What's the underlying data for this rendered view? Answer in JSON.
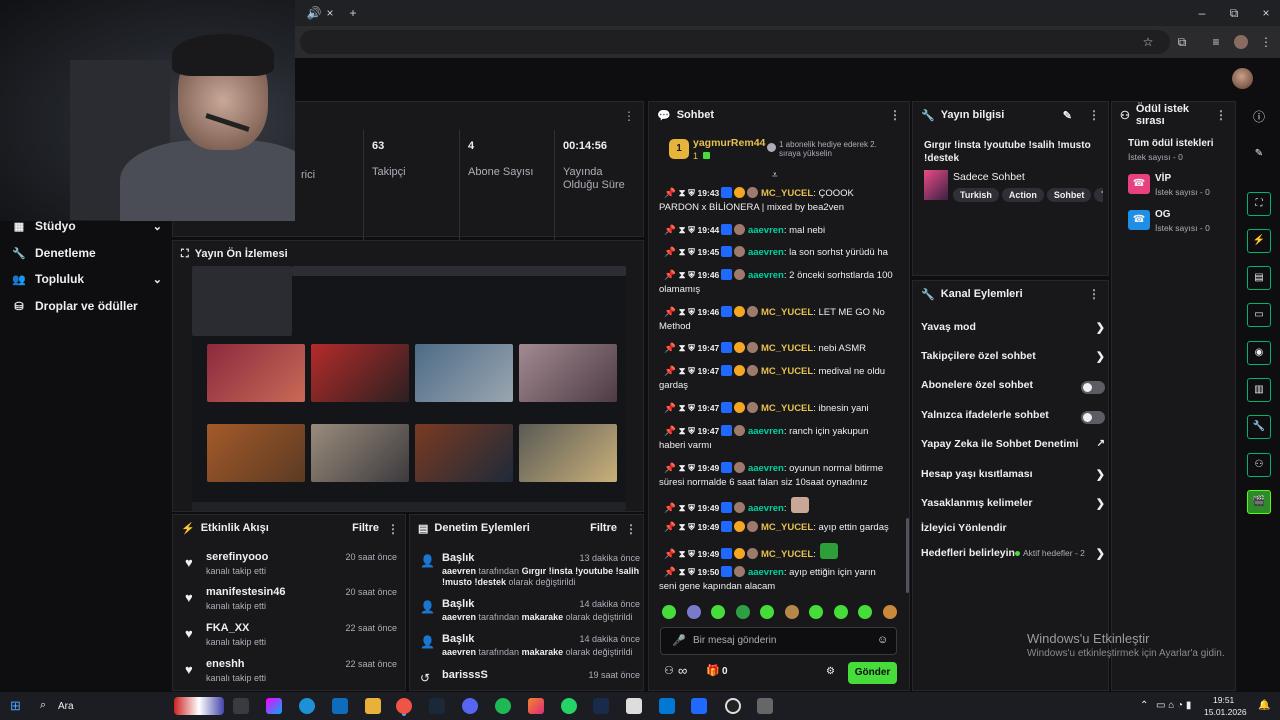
{
  "browser": {
    "tab_close": "×",
    "tab_add": "+",
    "window_controls": [
      "–",
      "⧉",
      "×"
    ]
  },
  "nav": {
    "items": [
      {
        "label": "Stüdyo",
        "icon": "studio-icon",
        "expandable": true
      },
      {
        "label": "Denetleme",
        "icon": "wrench-icon",
        "expandable": false
      },
      {
        "label": "Topluluk",
        "icon": "community-icon",
        "expandable": true
      },
      {
        "label": "Droplar ve ödüller",
        "icon": "drops-icon",
        "expandable": false
      }
    ]
  },
  "stats": {
    "partial_label": "rici",
    "followers_value": "63",
    "followers_label": "Takipçi",
    "subs_value": "4",
    "subs_label": "Abone Sayısı",
    "uptime_value": "00:14:56",
    "uptime_label": "Yayında Olduğu Süre"
  },
  "preview": {
    "title": "Yayın Ön İzlemesi"
  },
  "activity": {
    "title": "Etkinlik Akışı",
    "filter": "Filtre",
    "items": [
      {
        "name": "serefinyooo",
        "action": "kanalı takip etti",
        "time": "20 saat önce"
      },
      {
        "name": "manifestesin46",
        "action": "kanalı takip etti",
        "time": "20 saat önce"
      },
      {
        "name": "FKA_XX",
        "action": "kanalı takip etti",
        "time": "22 saat önce"
      },
      {
        "name": "eneshh",
        "action": "kanalı takip etti",
        "time": "22 saat önce"
      }
    ]
  },
  "modactions": {
    "title": "Denetim Eylemleri",
    "filter": "Filtre",
    "items": [
      {
        "title": "Başlık",
        "time": "13 dakika önce",
        "user": "aaevren",
        "mid": " tarafından ",
        "value": "Gırgır !insta !youtube !salih !musto !destek",
        "end": " olarak değiştirildi"
      },
      {
        "title": "Başlık",
        "time": "14 dakika önce",
        "user": "aaevren",
        "mid": " tarafından ",
        "value": "makarake",
        "end": " olarak değiştirildi"
      },
      {
        "title": "Başlık",
        "time": "14 dakika önce",
        "user": "aaevren",
        "mid": " tarafından ",
        "value": "makarake",
        "end": " olarak değiştirildi"
      },
      {
        "title": "barisssS",
        "time": "19 saat önce",
        "user": "",
        "mid": "",
        "value": "",
        "end": ""
      }
    ]
  },
  "chat": {
    "title": "Sohbet",
    "pinned_user": "yagmurRem44",
    "pinned_count": "1",
    "pinned_text": "1 abonelik hediye ederek 2. sıraya yükselin",
    "pinned_badge": "1",
    "messages": [
      {
        "time": "19:43",
        "gold": true,
        "user": "MC_YUCEL",
        "color": "gold",
        "text": "ÇOOOK PARDON x BİLİONERA | mixed by bea2ven"
      },
      {
        "time": "19:44",
        "gold": false,
        "user": "aaevren",
        "color": "green",
        "text": "mal nebi"
      },
      {
        "time": "19:45",
        "gold": false,
        "user": "aaevren",
        "color": "green",
        "text": "la son sorhst yürüdü ha"
      },
      {
        "time": "19:46",
        "gold": false,
        "user": "aaevren",
        "color": "green",
        "text": "2 önceki sorhstlarda 100 olamamış"
      },
      {
        "time": "19:46",
        "gold": true,
        "user": "MC_YUCEL",
        "color": "gold",
        "text": "LET ME GO No Method"
      },
      {
        "time": "19:47",
        "gold": true,
        "user": "MC_YUCEL",
        "color": "gold",
        "text": "nebi ASMR"
      },
      {
        "time": "19:47",
        "gold": true,
        "user": "MC_YUCEL",
        "color": "gold",
        "text": "medival ne oldu gardaş"
      },
      {
        "time": "19:47",
        "gold": true,
        "user": "MC_YUCEL",
        "color": "gold",
        "text": "ibnesin yani"
      },
      {
        "time": "19:47",
        "gold": false,
        "user": "aaevren",
        "color": "green",
        "text": "ranch için yakupun haberi varmı"
      },
      {
        "time": "19:49",
        "gold": false,
        "user": "aaevren",
        "color": "green",
        "text": "oyunun normal bitirme süresi normalde 6 saat falan siz 10saat oynadınız"
      },
      {
        "time": "19:49",
        "gold": false,
        "user": "aaevren",
        "color": "green",
        "text": ""
      },
      {
        "time": "19:49",
        "gold": true,
        "user": "MC_YUCEL",
        "color": "gold",
        "text": "ayıp ettin gardaş"
      },
      {
        "time": "19:49",
        "gold": true,
        "user": "MC_YUCEL",
        "color": "gold",
        "text": ""
      },
      {
        "time": "19:50",
        "gold": false,
        "user": "aaevren",
        "color": "green",
        "text": "ayıp ettiğin için yarın seni gene kapından alacam"
      }
    ],
    "input_placeholder": "Bir mesaj gönderin",
    "infinity": "∞",
    "gift_count": "0",
    "send": "Gönder"
  },
  "streaminfo": {
    "title": "Yayın bilgisi",
    "stream_title": "Gırgır !insta !youtube !salih !musto !destek",
    "category": "Sadece Sohbet",
    "tags": [
      "Turkish",
      "Action",
      "Sohbet",
      "Tür"
    ]
  },
  "channel_actions": {
    "title": "Kanal Eylemleri",
    "items": [
      {
        "label": "Yavaş mod",
        "kind": "chevron"
      },
      {
        "label": "Takipçilere özel sohbet",
        "kind": "chevron"
      },
      {
        "label": "Abonelere özel sohbet",
        "kind": "toggle"
      },
      {
        "label": "Yalnızca ifadelerle sohbet",
        "kind": "toggle"
      },
      {
        "label": "Yapay Zeka ile Sohbet Denetimi",
        "kind": "external"
      },
      {
        "label": "Hesap yaşı kısıtlaması",
        "kind": "chevron"
      },
      {
        "label": "Yasaklanmış kelimeler",
        "kind": "chevron"
      },
      {
        "label": "İzleyici Yönlendir",
        "kind": "none"
      },
      {
        "label": "Hedefleri belirleyin",
        "kind": "goals"
      }
    ],
    "goals_status": "Aktif hedefler - 2"
  },
  "rewards": {
    "title": "Ödül istek sırası",
    "all_title": "Tüm ödül istekleri",
    "all_count": "İstek sayısı - 0",
    "items": [
      {
        "name": "VİP",
        "count": "İstek sayısı - 0",
        "color": "#e9407f"
      },
      {
        "name": "OG",
        "count": "İstek sayısı - 0",
        "color": "#1f8fe6"
      }
    ]
  },
  "watermark": {
    "line1": "Windows'u Etkinleştir",
    "line2": "Windows'u etkinleştirmek için Ayarlar'a gidin."
  },
  "taskbar": {
    "search": "Ara",
    "time": "19:51",
    "date": "15.01.2026"
  },
  "colors": {
    "accent": "#53fc18",
    "gold": "#e7c04d",
    "green_user": "#00d1a1"
  }
}
